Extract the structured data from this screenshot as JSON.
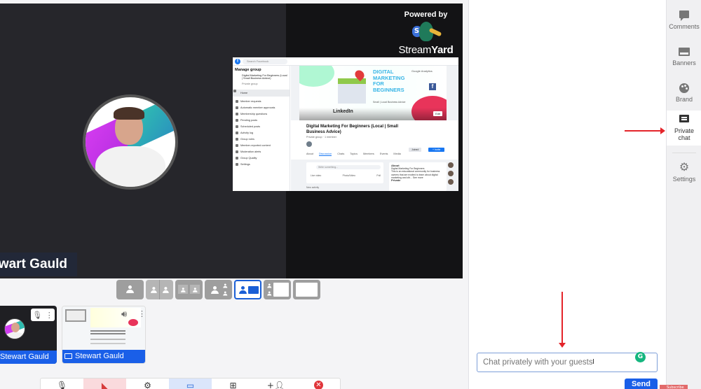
{
  "stage": {
    "presenter_name": "Stewart Gauld",
    "powered_by": {
      "label": "Powered by",
      "brand_light": "Stream",
      "brand_bold": "Yard",
      "badge_letter": "S"
    }
  },
  "shared_screen": {
    "search_placeholder": "Search Facebook",
    "sidebar_title": "Manage group",
    "group_name_short": "Digital Marketing For Beginners (Local | Small Business Advice)",
    "group_privacy": "Private group",
    "sidebar_items": [
      "Home",
      "Member requests",
      "Automatic member approvals",
      "Membership questions",
      "Pending posts",
      "Scheduled posts",
      "Activity log",
      "Group rules",
      "Member-reported content",
      "Moderation alerts",
      "Group Quality",
      "Settings"
    ],
    "cover": {
      "headline": "DIGITAL MARKETING FOR BEGINNERS",
      "subtitle": "Small | Local Business Advice",
      "linkedin": "LinkedIn",
      "google_analytics": "Google Analytics",
      "fb_glyph": "f",
      "edit": "Edit"
    },
    "group_title": "Digital Marketing For Beginners (Local | Small Business Advice)",
    "group_meta": "Private group · 1 member",
    "joined_label": "Joined",
    "invite_label": "+ Invite",
    "tabs": [
      "About",
      "Discussion",
      "Chats",
      "Topics",
      "Members",
      "Events",
      "Media"
    ],
    "active_tab": "Discussion",
    "composer_placeholder": "Write something...",
    "composer_actions": [
      "Live video",
      "Photo/Video",
      "Poll"
    ],
    "about_title": "About",
    "about_name": "Digital Marketing For Beginners",
    "about_text": "This is an educational community for business owners that are excited to learn about digital marketing and oth... See more",
    "about_privacy": "Private",
    "new_activity": "New activity"
  },
  "layouts": {
    "options": [
      "solo",
      "cropped",
      "group",
      "leader",
      "screen-sidebar",
      "screen-thin",
      "screen-only"
    ],
    "selected": "screen-sidebar"
  },
  "guests": [
    {
      "name": "Stewart Gauld",
      "type": "camera"
    },
    {
      "name": "Stewart Gauld",
      "type": "screen"
    }
  ],
  "toolbar": {
    "buttons": [
      "mic",
      "camera-off",
      "settings",
      "share-screen",
      "add-media",
      "invite",
      "leave"
    ],
    "active": "share-screen",
    "muted": "camera-off"
  },
  "chat": {
    "placeholder": "Chat privately with your guests",
    "cursor_glyph": "I",
    "grammarly_glyph": "G",
    "send_label": "Send"
  },
  "sidebar": {
    "items": [
      {
        "id": "comments",
        "label": "Comments"
      },
      {
        "id": "banners",
        "label": "Banners"
      },
      {
        "id": "brand",
        "label": "Brand"
      },
      {
        "id": "private-chat",
        "label": "Private chat"
      },
      {
        "id": "settings",
        "label": "Settings"
      }
    ],
    "active": "private-chat"
  },
  "overlay": {
    "subscribe_label": "Subscribe"
  },
  "colors": {
    "accent": "#1a5fe8",
    "stage_bg": "#26262b",
    "annotation_red": "#e4242a",
    "leave_red": "#e0353a"
  }
}
